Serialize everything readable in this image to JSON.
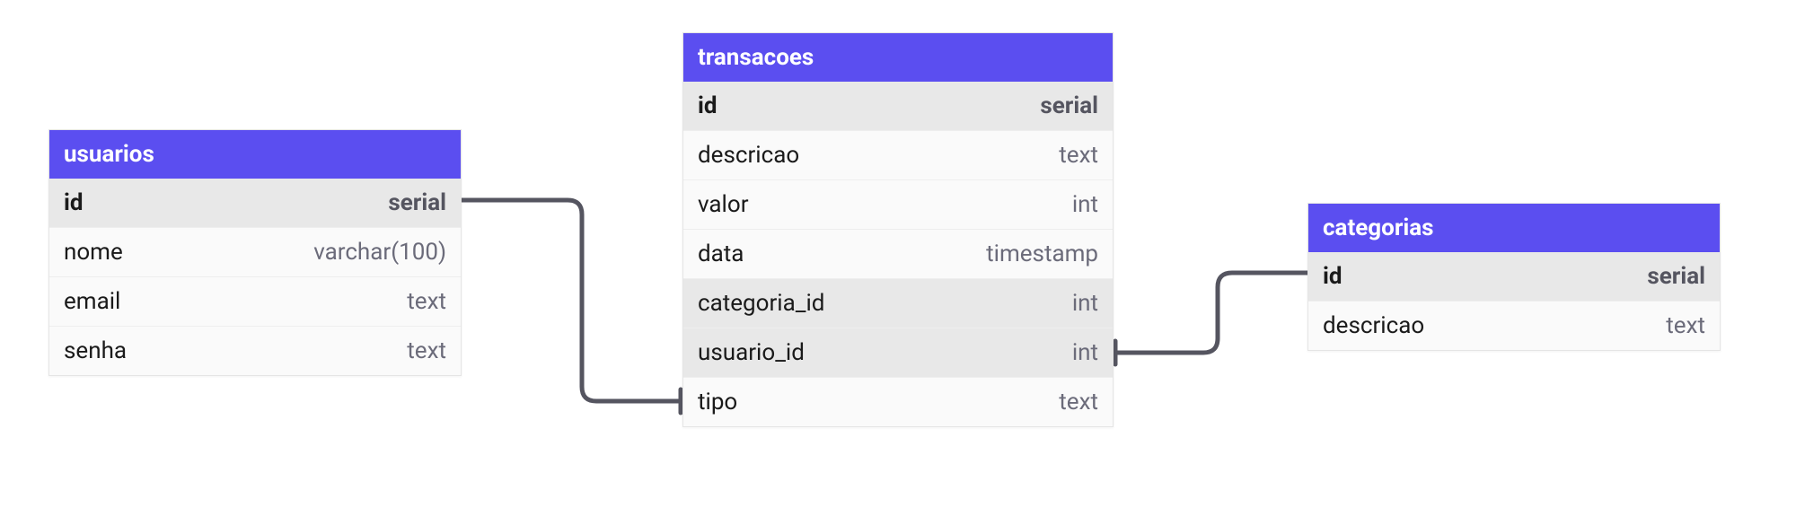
{
  "tables": {
    "usuarios": {
      "title": "usuarios",
      "columns": [
        {
          "name": "id",
          "type": "serial",
          "pk": true
        },
        {
          "name": "nome",
          "type": "varchar(100)"
        },
        {
          "name": "email",
          "type": "text"
        },
        {
          "name": "senha",
          "type": "text"
        }
      ]
    },
    "transacoes": {
      "title": "transacoes",
      "columns": [
        {
          "name": "id",
          "type": "serial",
          "pk": true
        },
        {
          "name": "descricao",
          "type": "text"
        },
        {
          "name": "valor",
          "type": "int"
        },
        {
          "name": "data",
          "type": "timestamp"
        },
        {
          "name": "categoria_id",
          "type": "int",
          "fk": true
        },
        {
          "name": "usuario_id",
          "type": "int",
          "fk": true
        },
        {
          "name": "tipo",
          "type": "text"
        }
      ]
    },
    "categorias": {
      "title": "categorias",
      "columns": [
        {
          "name": "id",
          "type": "serial",
          "pk": true
        },
        {
          "name": "descricao",
          "type": "text"
        }
      ]
    }
  },
  "relationships": [
    {
      "from_table": "usuarios",
      "from_column": "id",
      "to_table": "transacoes",
      "to_column": "usuario_id"
    },
    {
      "from_table": "transacoes",
      "from_column": "categoria_id",
      "to_table": "categorias",
      "to_column": "id"
    }
  ],
  "colors": {
    "header_bg": "#5b4ef0",
    "header_fg": "#ffffff",
    "row_bg": "#fafafa",
    "shaded_row_bg": "#e8e8e8",
    "type_fg": "#6b6b7a",
    "connector": "#555560"
  }
}
